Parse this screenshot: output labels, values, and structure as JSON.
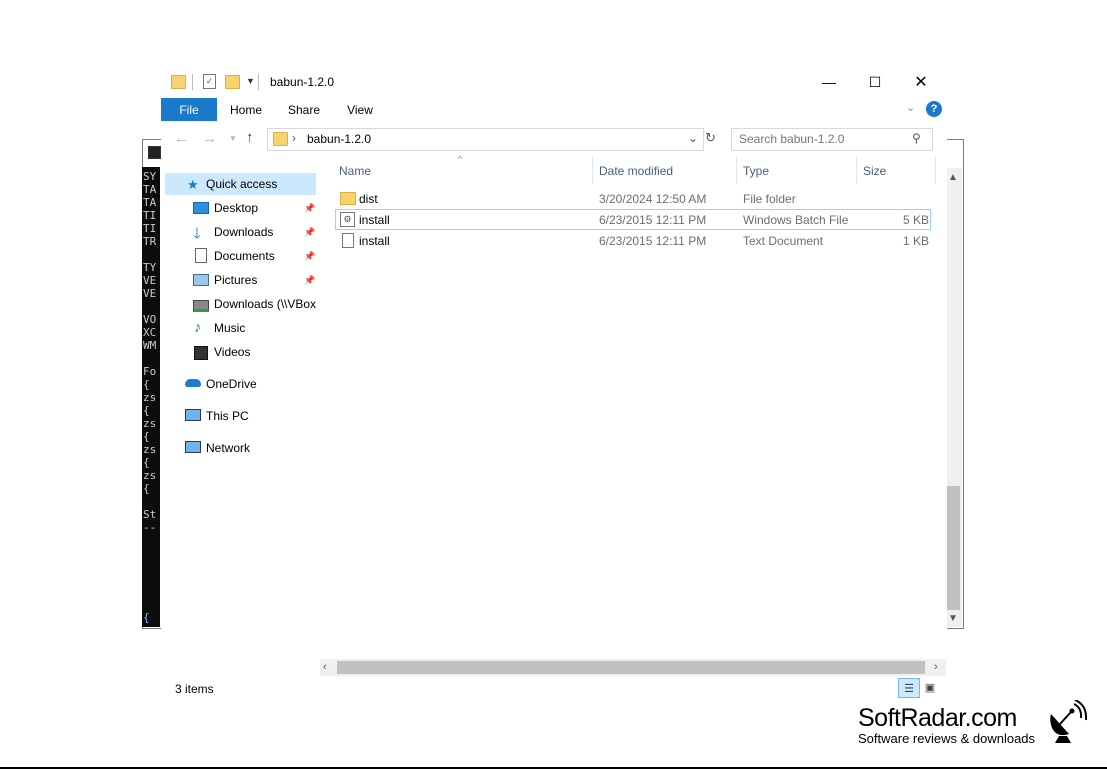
{
  "window": {
    "title": "babun-1.2.0"
  },
  "ribbon": {
    "tabs": [
      "File",
      "Home",
      "Share",
      "View"
    ],
    "help_glyph": "?"
  },
  "address": {
    "path": "babun-1.2.0",
    "search_placeholder": "Search babun-1.2.0"
  },
  "nav": {
    "quick_access": "Quick access",
    "items": [
      {
        "label": "Desktop",
        "icon": "desktop-icon",
        "pinned": true
      },
      {
        "label": "Downloads",
        "icon": "downloads-icon",
        "pinned": true
      },
      {
        "label": "Documents",
        "icon": "documents-icon",
        "pinned": true
      },
      {
        "label": "Pictures",
        "icon": "pictures-icon",
        "pinned": true
      },
      {
        "label": "Downloads (\\\\VBox",
        "icon": "network-drive-icon",
        "pinned": false
      },
      {
        "label": "Music",
        "icon": "music-icon",
        "pinned": false
      },
      {
        "label": "Videos",
        "icon": "videos-icon",
        "pinned": false
      }
    ],
    "onedrive": "OneDrive",
    "this_pc": "This PC",
    "network": "Network"
  },
  "columns": {
    "name": "Name",
    "date": "Date modified",
    "type": "Type",
    "size": "Size"
  },
  "files": [
    {
      "name": "dist",
      "date": "3/20/2024 12:50 AM",
      "type": "File folder",
      "size": "",
      "icon": "folder-icon"
    },
    {
      "name": "install",
      "date": "6/23/2015 12:11 PM",
      "type": "Windows Batch File",
      "size": "5 KB",
      "icon": "batch-file-icon"
    },
    {
      "name": "install",
      "date": "6/23/2015 12:11 PM",
      "type": "Text Document",
      "size": "1 KB",
      "icon": "text-file-icon"
    }
  ],
  "status": {
    "items_count": "3 items"
  },
  "console_text": "SY\nTA\nTA\nTI\nTI\nTR\n\nTY\nVE\nVE\n\nVO\nXC\nWM\n\nFo\n{\nzs\n{\nzs\n{\nzs\n{\nzs\n{\n\nSt\n--",
  "console_brace": "{",
  "watermark": {
    "name": "SoftRadar.com",
    "tagline": "Software reviews & downloads"
  },
  "colors": {
    "accent": "#1979ca",
    "selection": "#cce8ff",
    "folder": "#f6d36c"
  }
}
